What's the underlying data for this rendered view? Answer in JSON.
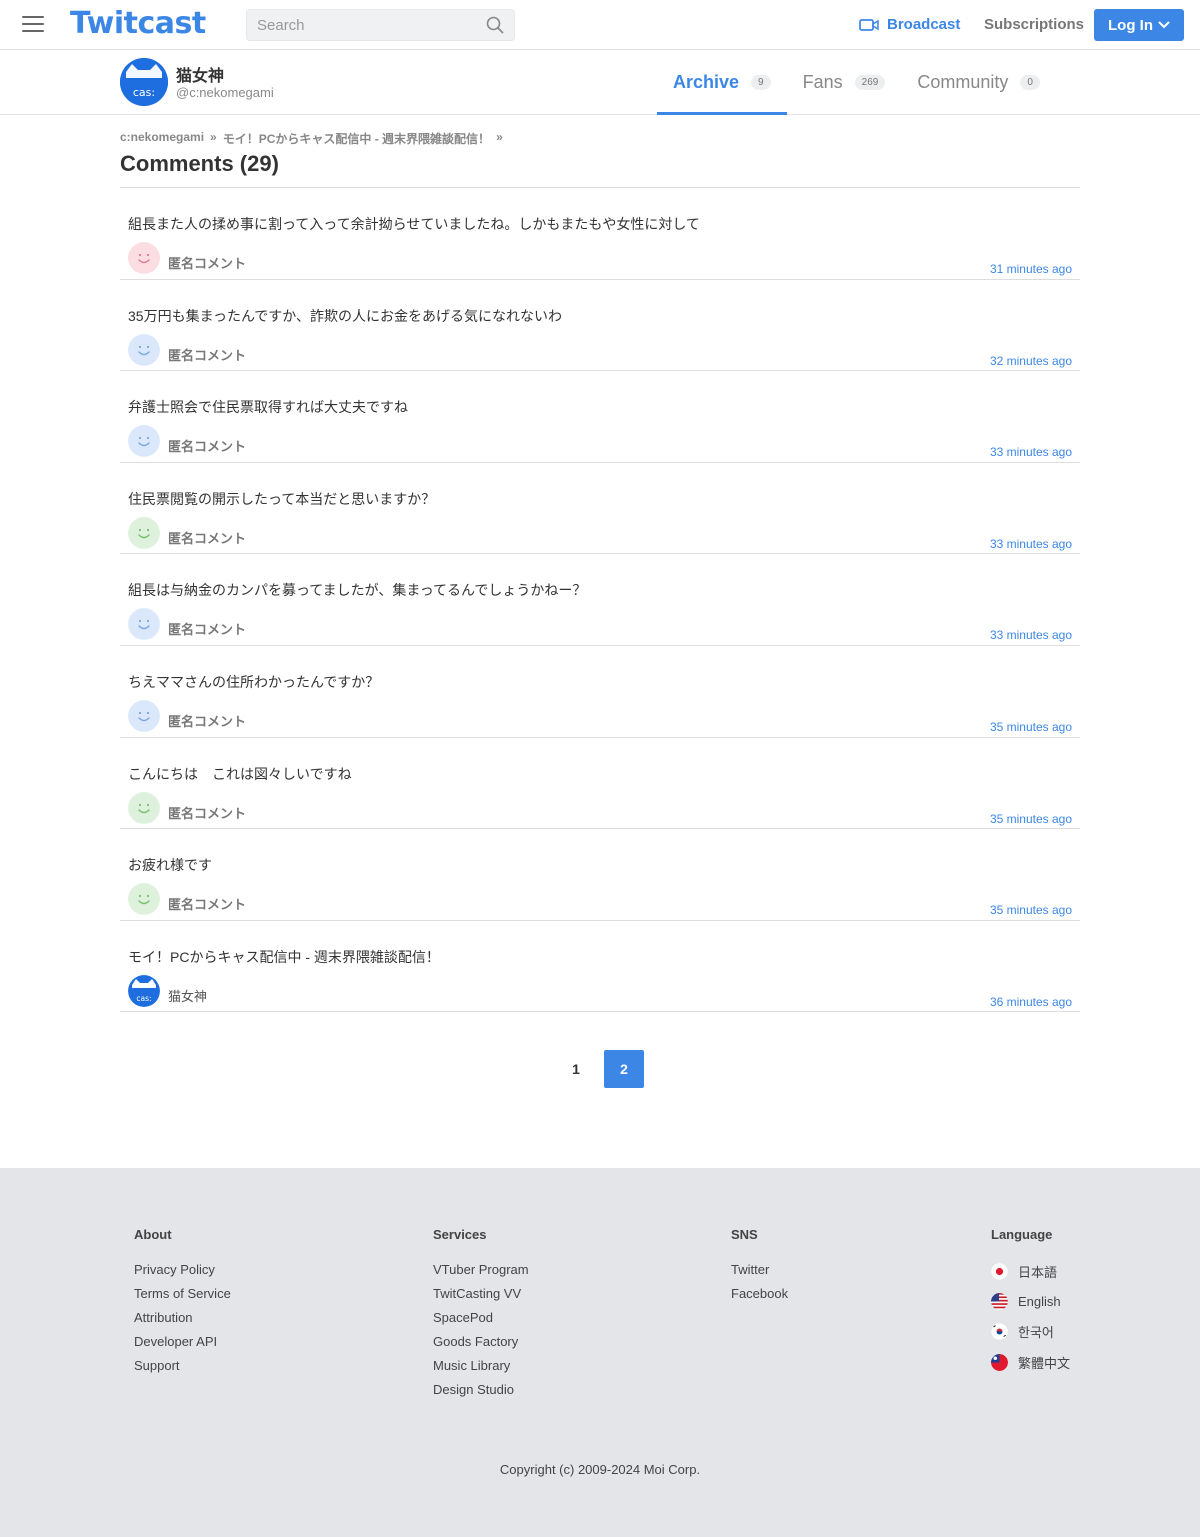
{
  "header": {
    "logo": "Twitcast",
    "search_placeholder": "Search",
    "broadcast_label": "Broadcast",
    "subscriptions_label": "Subscriptions",
    "login_label": "Log In"
  },
  "profile": {
    "name": "猫女神",
    "id": "@c:nekomegami",
    "avatar_text": "cas:",
    "tabs": [
      {
        "label": "Archive",
        "count": "9"
      },
      {
        "label": "Fans",
        "count": "269"
      },
      {
        "label": "Community",
        "count": "0"
      }
    ]
  },
  "breadcrumb": {
    "user": "c:nekomegami",
    "sep1": "»",
    "movie": "モイ！PCからキャス配信中 - 週末界隈雑談配信！",
    "sep2": "»"
  },
  "page_title": "Comments (29)",
  "comments": [
    {
      "text": "組長また人の揉め事に割って入って余計拗らせていましたね。しかもまたもや女性に対して",
      "author": "匿名コメント",
      "time": "31 minutes ago",
      "avatar": "anon-pink"
    },
    {
      "text": "35万円も集まったんですか、詐欺の人にお金をあげる気になれないわ",
      "author": "匿名コメント",
      "time": "32 minutes ago",
      "avatar": "anon-blue"
    },
    {
      "text": "弁護士照会で住民票取得すれば大丈夫ですね",
      "author": "匿名コメント",
      "time": "33 minutes ago",
      "avatar": "anon-blue"
    },
    {
      "text": "住民票閲覧の開示したって本当だと思いますか？",
      "author": "匿名コメント",
      "time": "33 minutes ago",
      "avatar": "anon-green"
    },
    {
      "text": "組長は与納金のカンパを募ってましたが、集まってるんでしょうかねー？",
      "author": "匿名コメント",
      "time": "33 minutes ago",
      "avatar": "anon-blue"
    },
    {
      "text": "ちえママさんの住所わかったんですか？",
      "author": "匿名コメント",
      "time": "35 minutes ago",
      "avatar": "anon-blue"
    },
    {
      "text": "こんにちは　これは図々しいですね",
      "author": "匿名コメント",
      "time": "35 minutes ago",
      "avatar": "anon-green"
    },
    {
      "text": "お疲れ様です",
      "author": "匿名コメント",
      "time": "35 minutes ago",
      "avatar": "anon-green"
    },
    {
      "text": "モイ！PCからキャス配信中 - 週末界隈雑談配信！",
      "author": "猫女神",
      "time": "36 minutes ago",
      "avatar": "owner"
    }
  ],
  "pagination": {
    "pages": [
      "1",
      "2"
    ],
    "current": "2"
  },
  "footer": {
    "about": {
      "title": "About",
      "links": [
        "Privacy Policy",
        "Terms of Service",
        "Attribution",
        "Developer API",
        "Support"
      ]
    },
    "services": {
      "title": "Services",
      "links": [
        "VTuber Program",
        "TwitCasting VV",
        "SpacePod",
        "Goods Factory",
        "Music Library",
        "Design Studio"
      ]
    },
    "sns": {
      "title": "SNS",
      "links": [
        "Twitter",
        "Facebook"
      ]
    },
    "language": {
      "title": "Language",
      "items": [
        "日本語",
        "English",
        "한국어",
        "繁體中文"
      ]
    },
    "copyright": "Copyright (c) 2009-2024 Moi Corp."
  },
  "colors": {
    "accent": "#3c87e6",
    "footer_bg": "#e3e5e8"
  }
}
